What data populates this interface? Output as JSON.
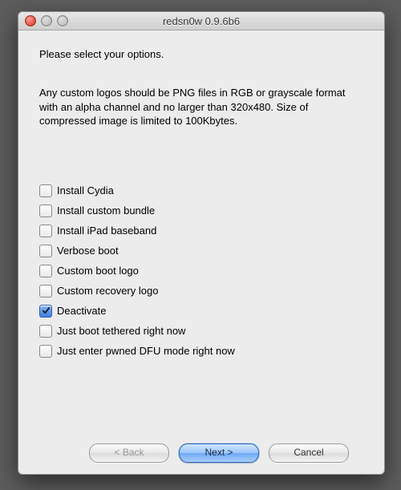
{
  "window": {
    "title": "redsn0w 0.9.6b6"
  },
  "prompt": "Please select your options.",
  "note": "Any custom logos should be PNG files in RGB or grayscale format with an alpha channel and no larger than 320x480. Size of compressed image is limited to 100Kbytes.",
  "options": [
    {
      "label": "Install Cydia",
      "checked": false
    },
    {
      "label": "Install custom bundle",
      "checked": false
    },
    {
      "label": "Install iPad baseband",
      "checked": false
    },
    {
      "label": "Verbose boot",
      "checked": false
    },
    {
      "label": "Custom boot logo",
      "checked": false
    },
    {
      "label": "Custom recovery logo",
      "checked": false
    },
    {
      "label": "Deactivate",
      "checked": true
    },
    {
      "label": "Just boot tethered right now",
      "checked": false
    },
    {
      "label": "Just enter pwned DFU mode right now",
      "checked": false
    }
  ],
  "buttons": {
    "back": "< Back",
    "next": "Next >",
    "cancel": "Cancel"
  }
}
